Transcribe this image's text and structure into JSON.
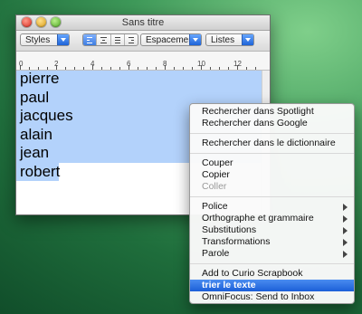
{
  "window": {
    "title": "Sans titre"
  },
  "toolbar": {
    "styles_label": "Styles",
    "spacing_label": "Espacement",
    "lists_label": "Listes"
  },
  "ruler": {
    "marks": [
      "0",
      "2",
      "4",
      "6",
      "8",
      "10",
      "12"
    ]
  },
  "document": {
    "lines": [
      "pierre",
      "paul",
      "jacques",
      "alain",
      "jean",
      "robert"
    ]
  },
  "context_menu": {
    "items": [
      {
        "label": "Rechercher dans Spotlight"
      },
      {
        "label": "Rechercher dans Google"
      },
      {
        "label": "Rechercher dans le dictionnaire"
      },
      {
        "label": "Couper"
      },
      {
        "label": "Copier"
      },
      {
        "label": "Coller",
        "disabled": true
      },
      {
        "label": "Police",
        "submenu": true
      },
      {
        "label": "Orthographe et grammaire",
        "submenu": true
      },
      {
        "label": "Substitutions",
        "submenu": true
      },
      {
        "label": "Transformations",
        "submenu": true
      },
      {
        "label": "Parole",
        "submenu": true
      },
      {
        "label": "Add to Curio Scrapbook"
      },
      {
        "label": "trier le texte",
        "highlighted": true
      },
      {
        "label": "OmniFocus: Send to Inbox"
      }
    ]
  }
}
